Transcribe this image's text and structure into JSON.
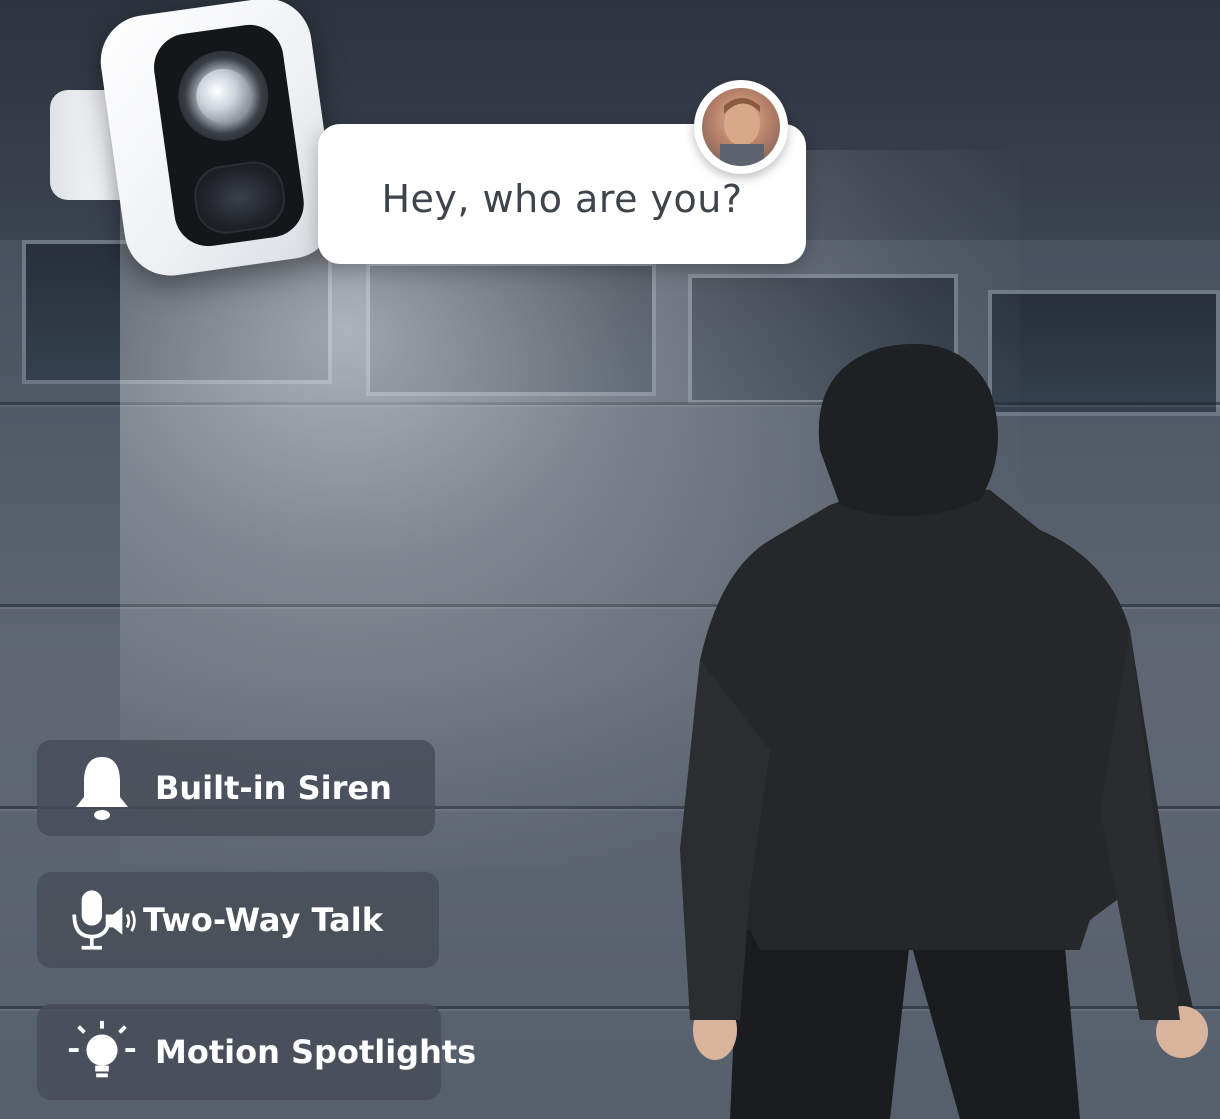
{
  "speech": {
    "text": "Hey, who are you?"
  },
  "features": [
    {
      "label": "Built-in Siren",
      "icon": "bell-icon"
    },
    {
      "label": "Two-Way Talk",
      "icon": "microphone-speaker-icon"
    },
    {
      "label": "Motion Spotlights",
      "icon": "lightbulb-icon"
    }
  ],
  "colors": {
    "pill_background": "#484e58",
    "pill_text": "#ffffff",
    "bubble_background": "#ffffff",
    "bubble_text": "#3e444c"
  }
}
